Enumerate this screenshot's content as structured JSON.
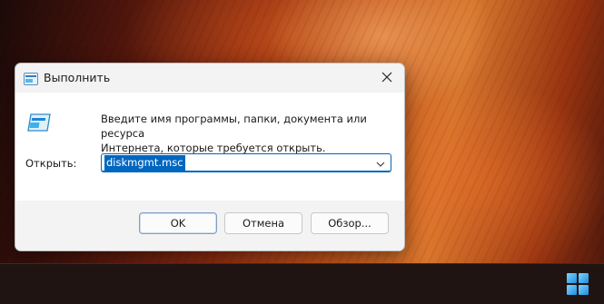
{
  "dialog": {
    "title": "Выполнить",
    "title_icon": "run-app-icon",
    "close_icon": "close-icon",
    "description_line1": "Введите имя программы, папки, документа или ресурса",
    "description_line2": "Интернета, которые требуется открыть.",
    "open_label": "Открыть:",
    "open_value": "diskmgmt.msc",
    "ok_label": "OK",
    "cancel_label": "Отмена",
    "browse_label": "Обзор..."
  },
  "taskbar": {
    "start_icon": "windows-start-icon"
  },
  "colors": {
    "accent": "#0067c0",
    "dialog_bg": "#f3f3f3",
    "content_bg": "#ffffff",
    "taskbar_bg": "#1f1412"
  }
}
